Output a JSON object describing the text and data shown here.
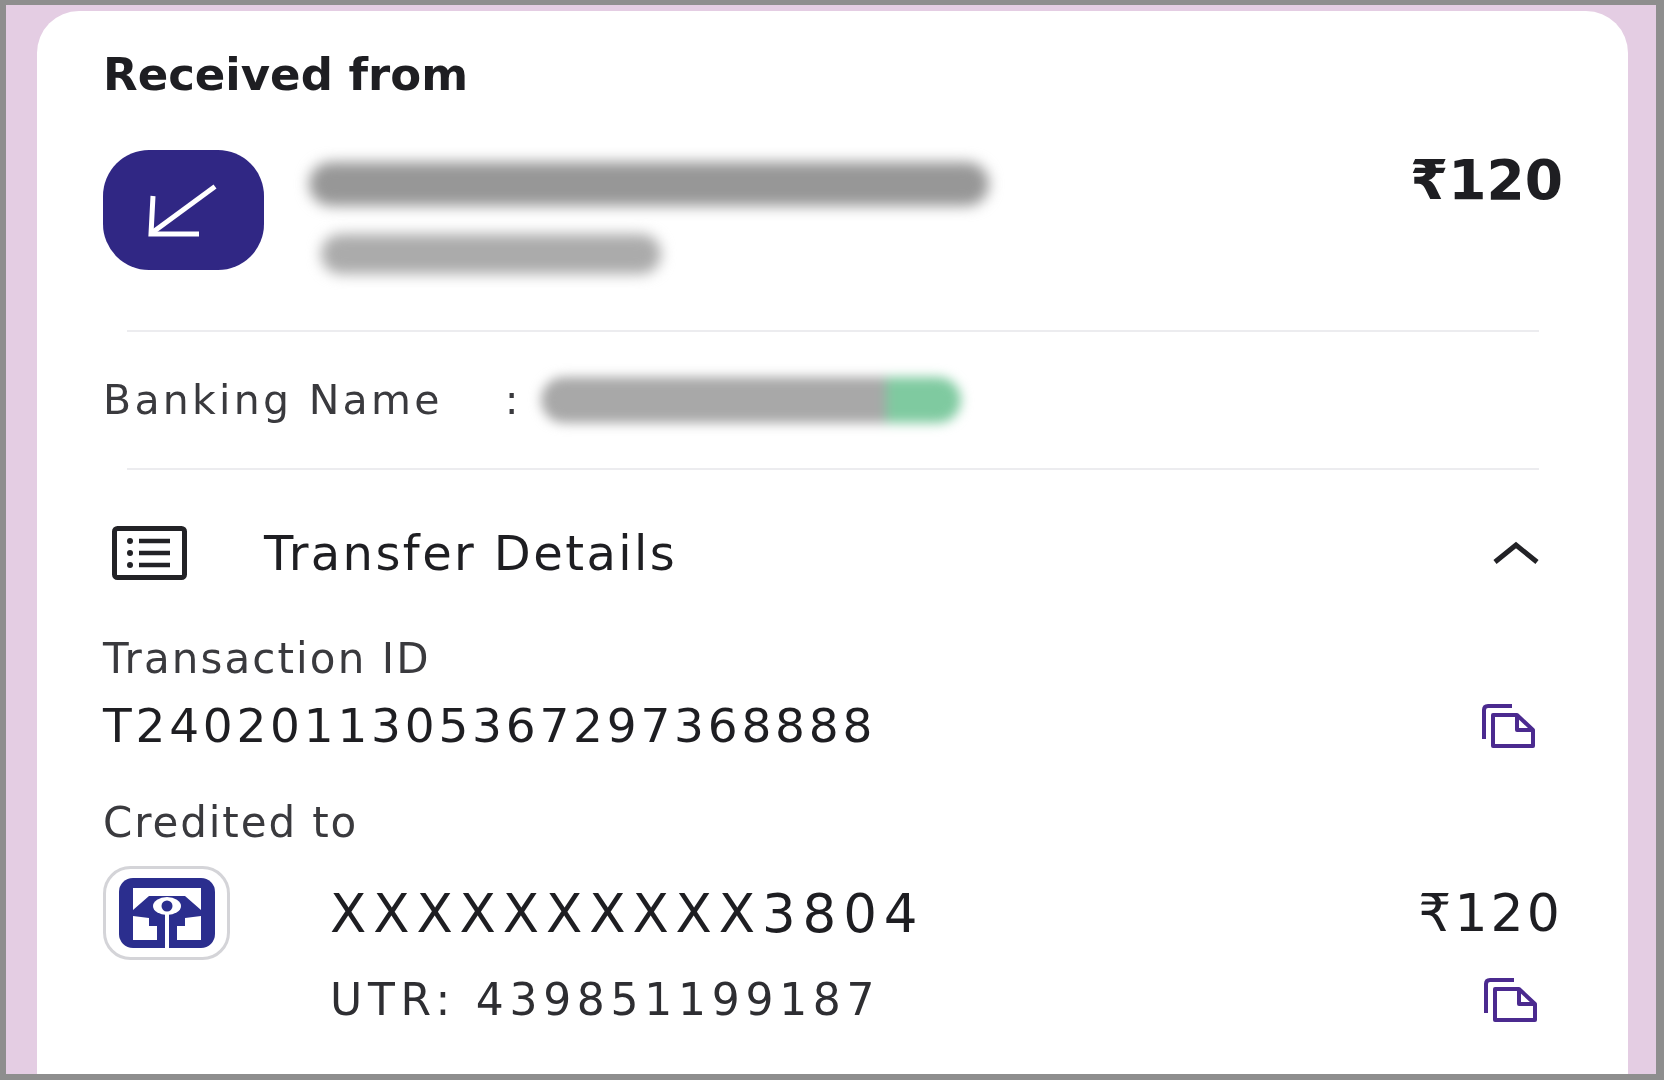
{
  "header": {
    "title": "Received from"
  },
  "sender": {
    "amount": "₹120"
  },
  "banking_name": {
    "label": "Banking Name",
    "separator": ":"
  },
  "transfer_details": {
    "title": "Transfer Details",
    "expanded": true,
    "transaction_id": {
      "label": "Transaction ID",
      "value": "T2402011305367297368888"
    },
    "credited_to": {
      "label": "Credited to",
      "account": "XXXXXXXXXX3804",
      "amount": "₹120",
      "utr": "UTR: 439851199187"
    }
  }
}
